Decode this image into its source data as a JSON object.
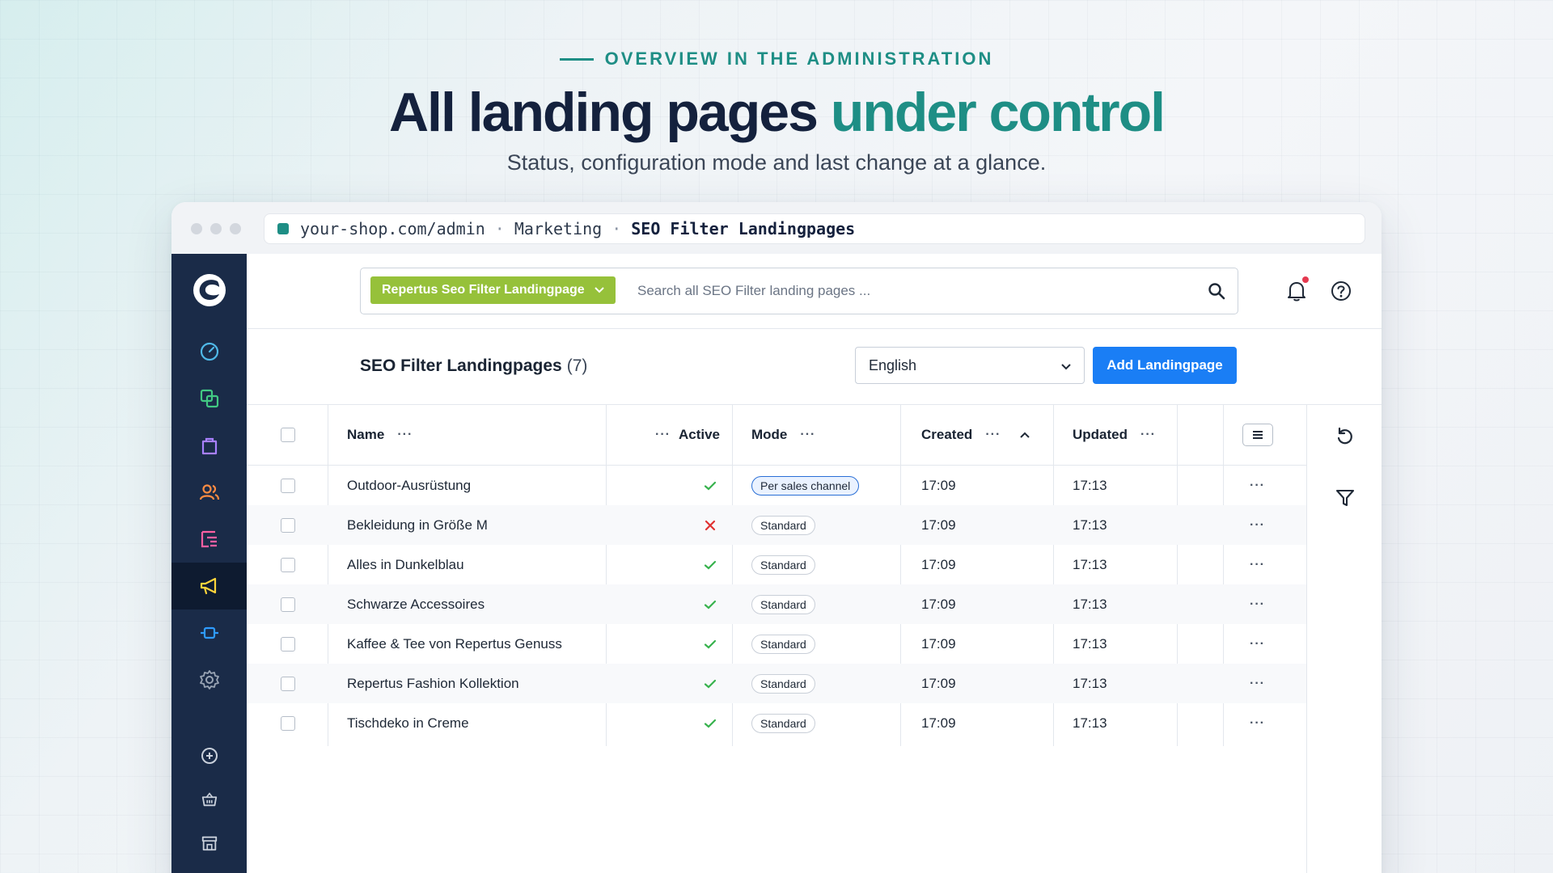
{
  "hero": {
    "eyebrow": "OVERVIEW IN THE ADMINISTRATION",
    "headline_main": "All landing pages ",
    "headline_accent": "under control",
    "subline": "Status, configuration mode and last change at a glance."
  },
  "browser": {
    "url_host": "your-shop.com/admin",
    "url_section": "Marketing",
    "url_page": "SEO Filter Landingpages",
    "separator": "·"
  },
  "appbar": {
    "search_type_label": "Repertus Seo Filter Landingpage",
    "search_placeholder": "Search all SEO Filter landing pages ..."
  },
  "smartbar": {
    "title": "SEO Filter Landingpages",
    "count": "(7)",
    "language_selected": "English",
    "add_button_label": "Add Landingpage"
  },
  "grid": {
    "columns": {
      "name": "Name",
      "active": "Active",
      "mode": "Mode",
      "created": "Created",
      "updated": "Updated"
    },
    "sort": {
      "column": "Created",
      "direction": "ascending"
    },
    "rows": [
      {
        "name": "Outdoor-Ausrüstung",
        "active": true,
        "mode": "Per sales channel",
        "created": "17:09",
        "updated": "17:13"
      },
      {
        "name": "Bekleidung in Größe M",
        "active": false,
        "mode": "Standard",
        "created": "17:09",
        "updated": "17:13"
      },
      {
        "name": "Alles in Dunkelblau",
        "active": true,
        "mode": "Standard",
        "created": "17:09",
        "updated": "17:13"
      },
      {
        "name": "Schwarze Accessoires",
        "active": true,
        "mode": "Standard",
        "created": "17:09",
        "updated": "17:13"
      },
      {
        "name": "Kaffee & Tee von Repertus Genuss",
        "active": true,
        "mode": "Standard",
        "created": "17:09",
        "updated": "17:13"
      },
      {
        "name": "Repertus Fashion Kollektion",
        "active": true,
        "mode": "Standard",
        "created": "17:09",
        "updated": "17:13"
      },
      {
        "name": "Tischdeko in Creme",
        "active": true,
        "mode": "Standard",
        "created": "17:09",
        "updated": "17:13"
      }
    ]
  },
  "sidebar": {
    "items": [
      {
        "icon": "dashboard-gauge-icon",
        "color": "#4fb8e8"
      },
      {
        "icon": "catalogue-layers-icon",
        "color": "#42c983"
      },
      {
        "icon": "orders-bag-icon",
        "color": "#a880ff"
      },
      {
        "icon": "customers-users-icon",
        "color": "#ff8c42"
      },
      {
        "icon": "content-list-icon",
        "color": "#ff5fa2"
      },
      {
        "icon": "marketing-megaphone-icon",
        "color": "#ffd43b",
        "active": true
      },
      {
        "icon": "extensions-plug-icon",
        "color": "#2f9bff"
      },
      {
        "icon": "settings-gear-icon",
        "color": "#9aa5b5"
      }
    ],
    "bottom_items": [
      {
        "icon": "add-circle-icon"
      },
      {
        "icon": "basket-icon"
      },
      {
        "icon": "storefront-icon"
      }
    ]
  },
  "colors": {
    "accent_teal": "#1e8e85",
    "headline_navy": "#14213d",
    "sidebar_bg": "#1a2b48",
    "primary_blue": "#1a7ef5",
    "type_pill_green": "#96c13a",
    "check_green": "#37b24d",
    "cross_red": "#e03131",
    "notification_dot": "#e53950"
  }
}
